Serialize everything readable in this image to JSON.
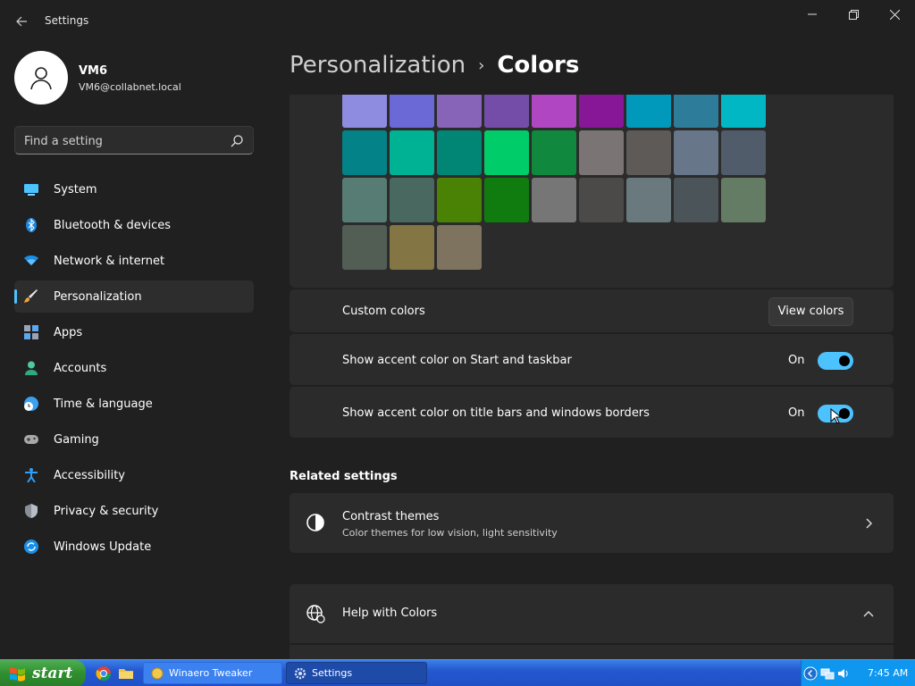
{
  "window": {
    "title": "Settings",
    "controls": {
      "minimize": "minimize-icon",
      "maximize": "restore-icon",
      "close": "close-icon"
    }
  },
  "profile": {
    "name": "VM6",
    "email": "VM6@collabnet.local"
  },
  "search": {
    "placeholder": "Find a setting"
  },
  "sidebar": {
    "items": [
      {
        "label": "System",
        "icon": "monitor-icon",
        "active": false
      },
      {
        "label": "Bluetooth & devices",
        "icon": "bluetooth-icon",
        "active": false
      },
      {
        "label": "Network & internet",
        "icon": "wifi-icon",
        "active": false
      },
      {
        "label": "Personalization",
        "icon": "paintbrush-icon",
        "active": true
      },
      {
        "label": "Apps",
        "icon": "apps-icon",
        "active": false
      },
      {
        "label": "Accounts",
        "icon": "person-icon",
        "active": false
      },
      {
        "label": "Time & language",
        "icon": "clock-globe-icon",
        "active": false
      },
      {
        "label": "Gaming",
        "icon": "gamepad-icon",
        "active": false
      },
      {
        "label": "Accessibility",
        "icon": "accessibility-icon",
        "active": false
      },
      {
        "label": "Privacy & security",
        "icon": "shield-icon",
        "active": false
      },
      {
        "label": "Windows Update",
        "icon": "update-icon",
        "active": false
      }
    ]
  },
  "header": {
    "parent": "Personalization",
    "separator": "›",
    "current": "Colors"
  },
  "palette": {
    "rows": [
      [
        "#8e8ce0",
        "#6b69d6",
        "#8764b8",
        "#744da9",
        "#b146c2",
        "#881798",
        "#0099bc",
        "#2d7d9a",
        "#00b7c3"
      ],
      [
        "#038387",
        "#00b294",
        "#018574",
        "#00cc6a",
        "#10893e",
        "#7a7574",
        "#5d5a58",
        "#68768a",
        "#515c6b"
      ],
      [
        "#567c73",
        "#486860",
        "#498205",
        "#107c10",
        "#767676",
        "#4c4a48",
        "#69797e",
        "#4a5459",
        "#647c64"
      ],
      [
        "#525e54",
        "#847545",
        "#7e735f"
      ]
    ]
  },
  "custom_colors": {
    "label": "Custom colors",
    "button": "View colors"
  },
  "accent_start": {
    "label": "Show accent color on Start and taskbar",
    "state": "On"
  },
  "accent_titlebars": {
    "label": "Show accent color on title bars and windows borders",
    "state": "On"
  },
  "related": {
    "title": "Related settings",
    "contrast": {
      "title": "Contrast themes",
      "subtitle": "Color themes for low vision, light sensitivity"
    }
  },
  "help": {
    "title": "Help with Colors"
  },
  "taskbar": {
    "start": "start",
    "tasks": [
      {
        "label": "Winaero Tweaker",
        "icon": "winaero-icon"
      },
      {
        "label": "Settings",
        "icon": "gear-icon"
      }
    ],
    "time": "7:45 AM"
  },
  "colors": {
    "accent": "#4cc2ff",
    "background": "#202020",
    "card": "#2b2b2b"
  }
}
